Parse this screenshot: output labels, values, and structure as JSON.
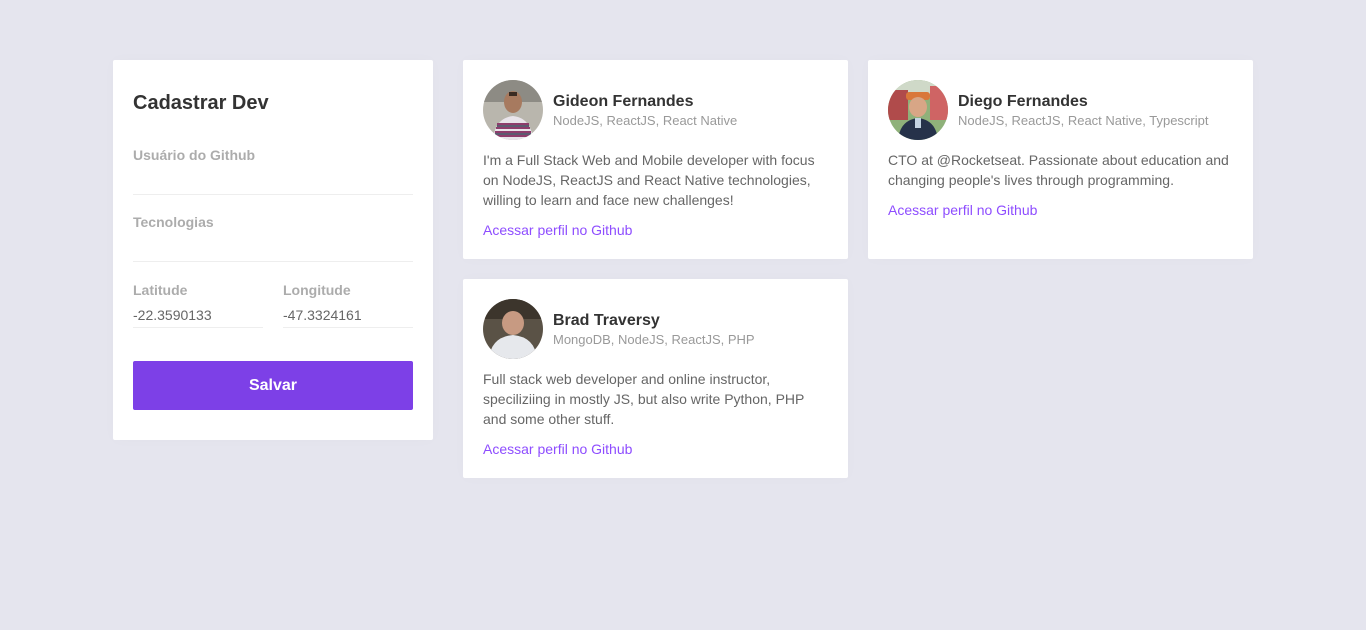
{
  "form": {
    "title": "Cadastrar Dev",
    "github_label": "Usuário do Github",
    "github_value": "",
    "techs_label": "Tecnologias",
    "techs_value": "",
    "latitude_label": "Latitude",
    "latitude_value": "-22.3590133",
    "longitude_label": "Longitude",
    "longitude_value": "-47.3324161",
    "save_label": "Salvar"
  },
  "devs": [
    {
      "name": "Gideon Fernandes",
      "techs": "NodeJS, ReactJS, React Native",
      "bio": "I'm a Full Stack Web and Mobile developer with focus on NodeJS, ReactJS and React Native technologies, willing to learn and face new challenges!",
      "link": "Acessar perfil no Github"
    },
    {
      "name": "Diego Fernandes",
      "techs": "NodeJS, ReactJS, React Native, Typescript",
      "bio": "CTO at @Rocketseat. Passionate about education and changing people's lives through programming.",
      "link": "Acessar perfil no Github"
    },
    {
      "name": "Brad Traversy",
      "techs": "MongoDB, NodeJS, ReactJS, PHP",
      "bio": "Full stack web developer and online instructor, speciliziing in mostly JS, but also write Python, PHP and some other stuff.",
      "link": "Acessar perfil no Github"
    }
  ],
  "colors": {
    "background": "#e5e5ee",
    "accent": "#7d40e7",
    "link": "#8e4dff"
  }
}
